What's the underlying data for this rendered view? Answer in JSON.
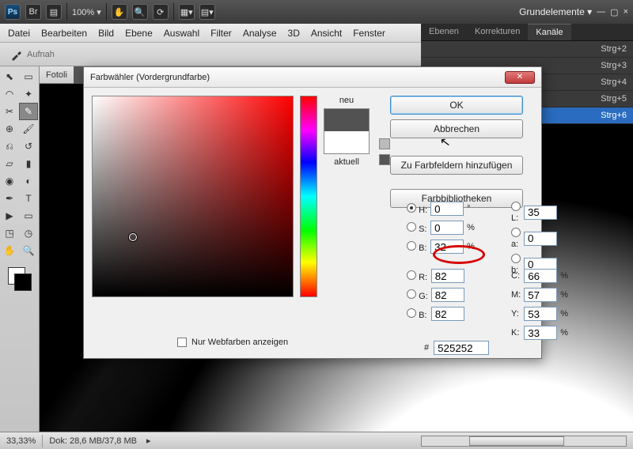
{
  "topbar": {
    "ps": "Ps",
    "br": "Br",
    "zoom": "100% ▾",
    "workspace_label": "Grundelemente ▾",
    "minus": "—",
    "square": "▢",
    "close": "×"
  },
  "menu": [
    "Datei",
    "Bearbeiten",
    "Bild",
    "Ebene",
    "Auswahl",
    "Filter",
    "Analyse",
    "3D",
    "Ansicht",
    "Fenster"
  ],
  "optbar": {
    "label1": "Aufnah",
    "label2": "Fotoli"
  },
  "tabs": {
    "ebenen": "Ebenen",
    "korrekturen": "Korrekturen",
    "kanaele": "Kanäle"
  },
  "channels": [
    {
      "shortcut": "Strg+2",
      "sel": false
    },
    {
      "shortcut": "Strg+3",
      "sel": false
    },
    {
      "shortcut": "Strg+4",
      "sel": false
    },
    {
      "shortcut": "Strg+5",
      "sel": false
    },
    {
      "shortcut": "Strg+6",
      "sel": true
    }
  ],
  "dialog": {
    "title": "Farbwähler (Vordergrundfarbe)",
    "neu": "neu",
    "aktuell": "aktuell",
    "ok": "OK",
    "cancel": "Abbrechen",
    "addswatch": "Zu Farbfeldern hinzufügen",
    "libraries": "Farbbibliotheken",
    "hsb": {
      "H": "H:",
      "S": "S:",
      "B": "B:",
      "Hval": "0",
      "Sval": "0",
      "Bval": "32",
      "deg": "°",
      "pct": "%"
    },
    "rgb": {
      "R": "R:",
      "G": "G:",
      "B": "B:",
      "Rval": "82",
      "Gval": "82",
      "Bval": "82"
    },
    "lab": {
      "L": "L:",
      "a": "a:",
      "b": "b:",
      "Lval": "35",
      "aval": "0",
      "bval": "0"
    },
    "cmyk": {
      "C": "C:",
      "M": "M:",
      "Y": "Y:",
      "K": "K:",
      "Cval": "66",
      "Mval": "57",
      "Yval": "53",
      "Kval": "33",
      "pct": "%"
    },
    "hexlabel": "#",
    "hexval": "525252",
    "webonly": "Nur Webfarben anzeigen"
  },
  "status": {
    "zoom": "33,33%",
    "dok": "Dok: 28,6 MB/37,8 MB"
  },
  "doc": {
    "tab": ""
  }
}
